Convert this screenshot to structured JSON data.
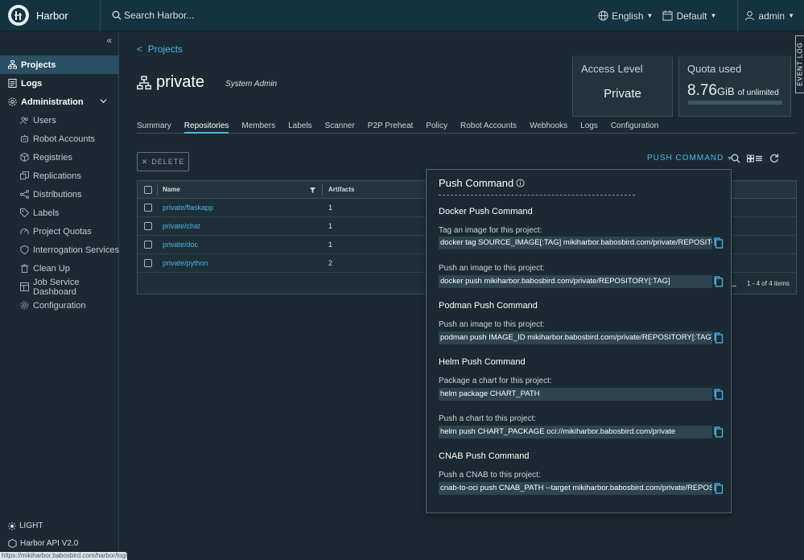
{
  "header": {
    "app_name": "Harbor",
    "search_placeholder": "Search Harbor...",
    "language": "English",
    "theme": "Default",
    "user": "admin"
  },
  "sidebar": {
    "items": [
      {
        "label": "Projects",
        "icon": "projects-icon",
        "active": true
      },
      {
        "label": "Logs",
        "icon": "logs-icon"
      },
      {
        "label": "Administration",
        "icon": "admin-icon"
      }
    ],
    "admin_items": [
      {
        "label": "Users",
        "icon": "users-icon"
      },
      {
        "label": "Robot Accounts",
        "icon": "robot-icon"
      },
      {
        "label": "Registries",
        "icon": "registries-icon"
      },
      {
        "label": "Replications",
        "icon": "replications-icon"
      },
      {
        "label": "Distributions",
        "icon": "distributions-icon"
      },
      {
        "label": "Labels",
        "icon": "labels-icon"
      },
      {
        "label": "Project Quotas",
        "icon": "quotas-icon"
      },
      {
        "label": "Interrogation Services",
        "icon": "shield-icon"
      },
      {
        "label": "Clean Up",
        "icon": "trash-icon"
      },
      {
        "label": "Job Service Dashboard",
        "icon": "dashboard-icon"
      },
      {
        "label": "Configuration",
        "icon": "gear-icon"
      }
    ],
    "theme_toggle": "LIGHT",
    "api_link": "Harbor API V2.0"
  },
  "status_url": "https://mikiharbor.babosbird.com/harbor/logs",
  "project": {
    "breadcrumb": "Projects",
    "name": "private",
    "role": "System Admin",
    "access_level_label": "Access Level",
    "access_level_value": "Private",
    "quota_label": "Quota used",
    "quota_value": "8.76",
    "quota_unit": "GiB",
    "quota_of": "of unlimited"
  },
  "tabs": [
    "Summary",
    "Repositories",
    "Members",
    "Labels",
    "Scanner",
    "P2P Preheat",
    "Policy",
    "Robot Accounts",
    "Webhooks",
    "Logs",
    "Configuration"
  ],
  "toolbar": {
    "delete_label": "DELETE",
    "push_command_label": "PUSH COMMAND"
  },
  "grid": {
    "columns": [
      "Name",
      "Artifacts"
    ],
    "rows": [
      {
        "name": "private/flaskapp",
        "artifacts": "1"
      },
      {
        "name": "private/chat",
        "artifacts": "1"
      },
      {
        "name": "private/doc",
        "artifacts": "1"
      },
      {
        "name": "private/python",
        "artifacts": "2"
      }
    ],
    "footer": "1 - 4 of 4 items"
  },
  "push_popover": {
    "title": "Push Command",
    "docker_title": "Docker Push Command",
    "docker_tag_label": "Tag an image for this project:",
    "docker_tag_cmd": "docker tag SOURCE_IMAGE[:TAG] mikiharbor.babosbird.com/private/REPOSITORY[:TAG]",
    "docker_push_label": "Push an image to this project:",
    "docker_push_cmd": "docker push mikiharbor.babosbird.com/private/REPOSITORY[:TAG]",
    "podman_title": "Podman Push Command",
    "podman_push_label": "Push an image to this project:",
    "podman_push_cmd": "podman push IMAGE_ID mikiharbor.babosbird.com/private/REPOSITORY[:TAG]",
    "helm_title": "Helm Push Command",
    "helm_package_label": "Package a chart for this project:",
    "helm_package_cmd": "helm package CHART_PATH",
    "helm_push_label": "Push a chart to this project:",
    "helm_push_cmd": "helm push CHART_PACKAGE oci://mikiharbor.babosbird.com/private",
    "cnab_title": "CNAB Push Command",
    "cnab_push_label": "Push a CNAB to this project:",
    "cnab_push_cmd": "cnab-to-oci push CNAB_PATH --target mikiharbor.babosbird.com/private/REPOSITORY[:TAG]"
  },
  "event_log_label": "EVENT LOG",
  "colors": {
    "accent": "#4db5e8",
    "header_bg": "#14323f",
    "body_bg": "#1b2a32",
    "sidebar_active": "#2b4f63"
  }
}
